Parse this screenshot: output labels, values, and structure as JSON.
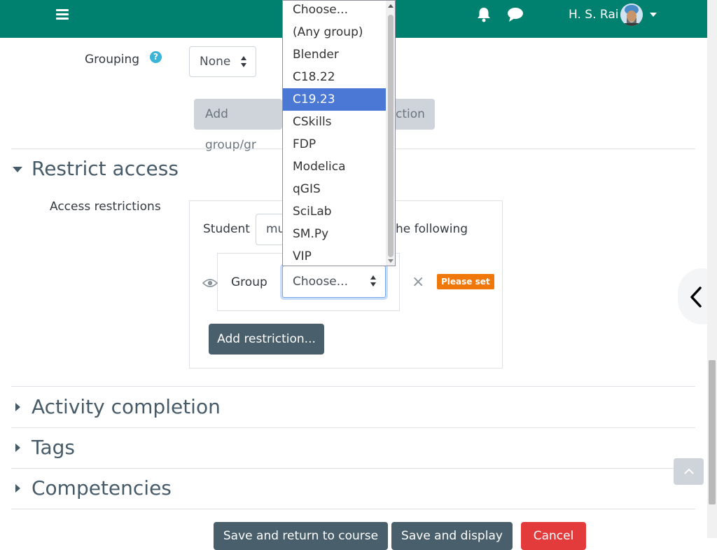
{
  "navbar": {
    "user_name": "H. S. Rai"
  },
  "grouping": {
    "label": "Grouping",
    "help_glyph": "?",
    "value": "None"
  },
  "add_group_restriction": {
    "label_left": "Add group/gr",
    "label_right": "ction"
  },
  "restrict_access": {
    "title": "Restrict access",
    "access_label": "Access restrictions",
    "student_label": "Student",
    "must_fragment": "mu",
    "following_fragment": "he following",
    "group_label": "Group",
    "group_select_value": "Choose...",
    "close_glyph": "×",
    "please_set": "Please set",
    "add_restriction": "Add restriction..."
  },
  "dropdown": {
    "options": [
      "Choose...",
      "(Any group)",
      "Blender",
      "C18.22",
      "C19.23",
      "CSkills",
      "FDP",
      "Modelica",
      "qGIS",
      "SciLab",
      "SM.Py",
      "VIP"
    ],
    "selected_index": 4
  },
  "sections": {
    "activity_completion": "Activity completion",
    "tags": "Tags",
    "competencies": "Competencies"
  },
  "footer": {
    "save_return": "Save and return to course",
    "save_display": "Save and display",
    "cancel": "Cancel"
  },
  "colors": {
    "navbar": "#00806e",
    "selected_option": "#4a78d4",
    "please_set": "#f0780a",
    "cancel": "#e33b3b",
    "secondary_button": "#495f6b"
  }
}
